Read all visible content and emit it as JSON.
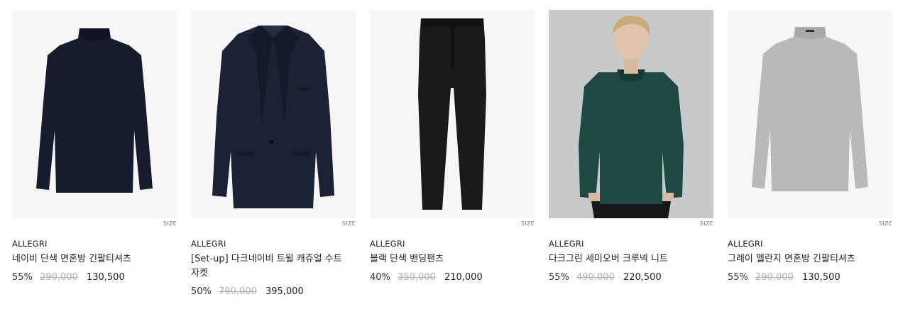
{
  "products": [
    {
      "image_icon": "navy-mockneck-longsleeve-icon",
      "size_label": "SIZE",
      "brand": "ALLEGRI",
      "name": "네이비 단색 면혼방 긴팔티셔츠",
      "discount": "55%",
      "original_price": "290,000",
      "sale_price": "130,500"
    },
    {
      "image_icon": "navy-blazer-icon",
      "size_label": "SIZE",
      "brand": "ALLEGRI",
      "name": "[Set-up] 다크네이비 트윌 캐쥬얼 수트 자켓",
      "discount": "50%",
      "original_price": "790,000",
      "sale_price": "395,000"
    },
    {
      "image_icon": "black-pants-icon",
      "size_label": "SIZE",
      "brand": "ALLEGRI",
      "name": "블랙 단색 밴딩팬츠",
      "discount": "40%",
      "original_price": "350,000",
      "sale_price": "210,000"
    },
    {
      "image_icon": "model-green-knit-sweater-icon",
      "size_label": "SIZE",
      "brand": "ALLEGRI",
      "name": "다크그린 세미오버 크루넥 니트",
      "discount": "55%",
      "original_price": "490,000",
      "sale_price": "220,500"
    },
    {
      "image_icon": "grey-mockneck-longsleeve-icon",
      "size_label": "SIZE",
      "brand": "ALLEGRI",
      "name": "그레이 멜란지 면혼방 긴팔티셔츠",
      "discount": "55%",
      "original_price": "290,000",
      "sale_price": "130,500"
    }
  ],
  "colors": {
    "navy": "#161c2e",
    "blazer_navy": "#1c2236",
    "black": "#1a1a1a",
    "green": "#1f4a43",
    "grey": "#b9b9b9",
    "thumb_bg": "#f6f6f6",
    "strike": "#b0b0b0"
  }
}
